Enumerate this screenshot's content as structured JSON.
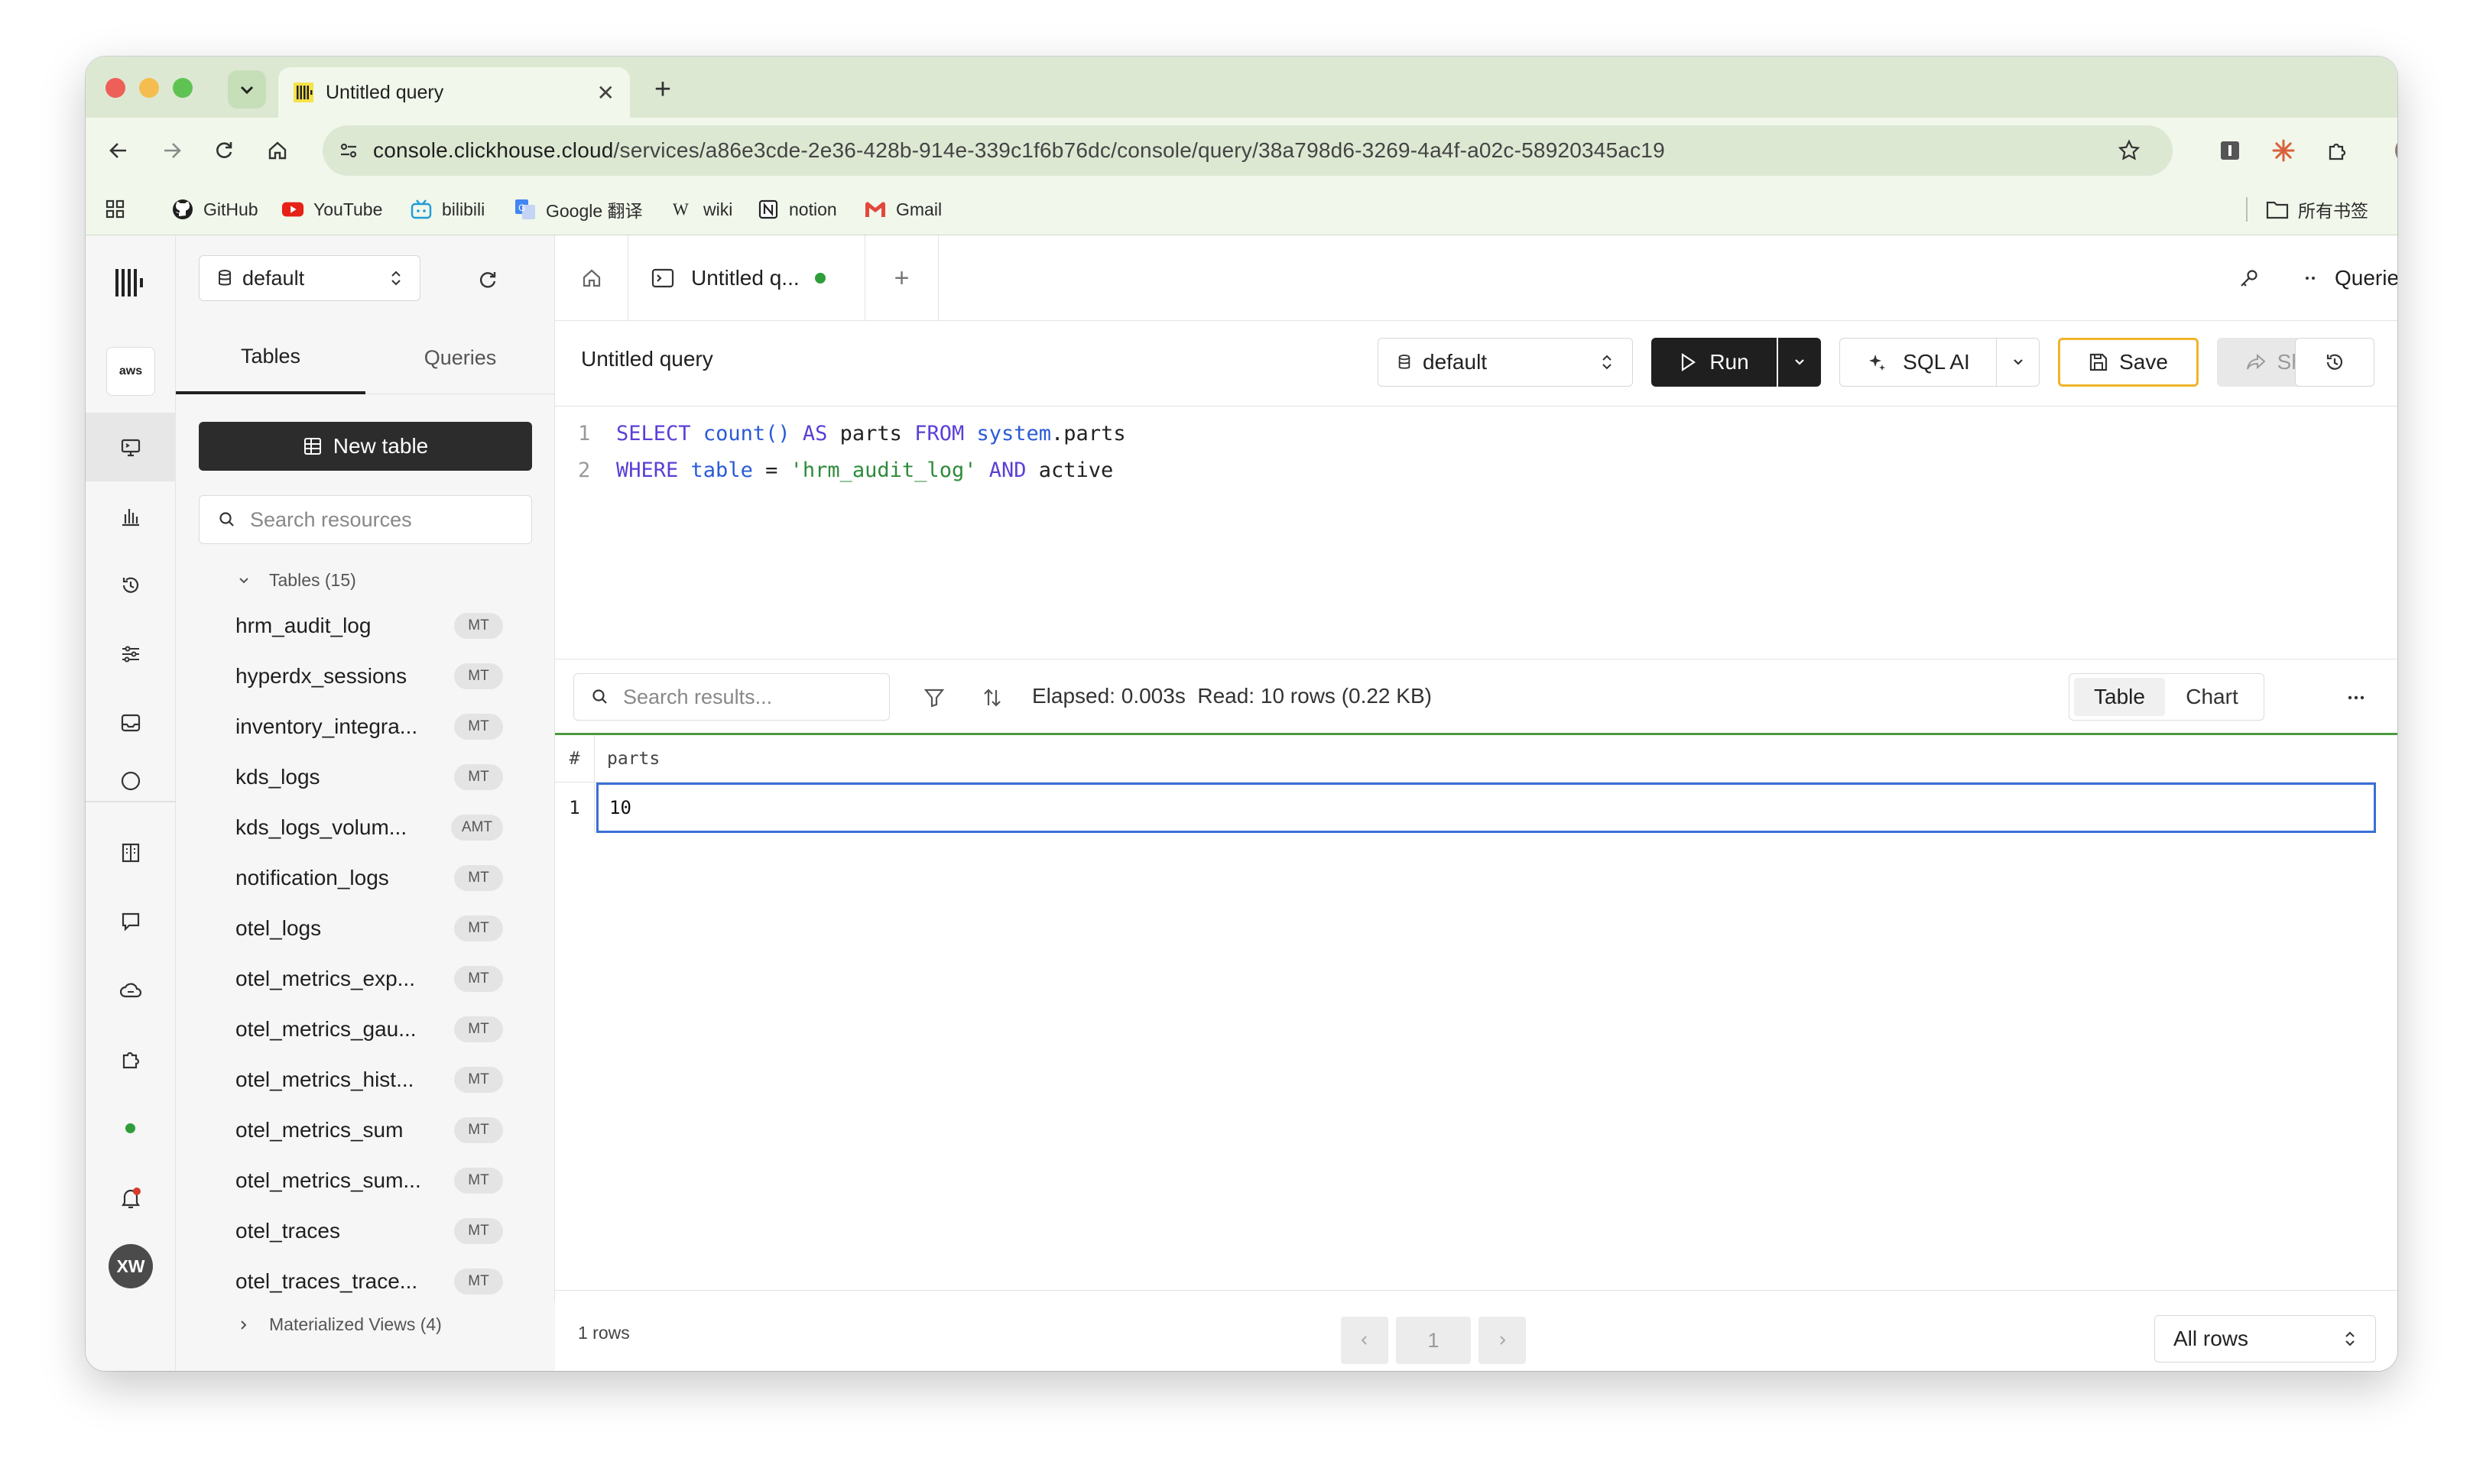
{
  "browser": {
    "tab_title": "Untitled query",
    "url_host": "console.clickhouse.cloud",
    "url_path": "/services/a86e3cde-2e36-428b-914e-339c1f6b76dc/console/query/38a798d6-3269-4a4f-a02c-58920345ac19",
    "bookmarks": [
      "GitHub",
      "YouTube",
      "bilibili",
      "Google 翻译",
      "wiki",
      "notion",
      "Gmail"
    ],
    "bookmarks_folder": "所有书签"
  },
  "sidebar": {
    "database": "default",
    "tabs": [
      "Tables",
      "Queries"
    ],
    "new_table": "New table",
    "search_placeholder": "Search resources",
    "tables_group": "Tables (15)",
    "tables": [
      {
        "name": "hrm_audit_log",
        "engine": "MT"
      },
      {
        "name": "hyperdx_sessions",
        "engine": "MT"
      },
      {
        "name": "inventory_integra...",
        "engine": "MT"
      },
      {
        "name": "kds_logs",
        "engine": "MT"
      },
      {
        "name": "kds_logs_volum...",
        "engine": "AMT"
      },
      {
        "name": "notification_logs",
        "engine": "MT"
      },
      {
        "name": "otel_logs",
        "engine": "MT"
      },
      {
        "name": "otel_metrics_exp...",
        "engine": "MT"
      },
      {
        "name": "otel_metrics_gau...",
        "engine": "MT"
      },
      {
        "name": "otel_metrics_hist...",
        "engine": "MT"
      },
      {
        "name": "otel_metrics_sum",
        "engine": "MT"
      },
      {
        "name": "otel_metrics_sum...",
        "engine": "MT"
      },
      {
        "name": "otel_traces",
        "engine": "MT"
      },
      {
        "name": "otel_traces_trace...",
        "engine": "MT"
      }
    ],
    "mv_group": "Materialized Views (4)"
  },
  "rail": {
    "avatar": "XW",
    "aws": "aws"
  },
  "query_tabs": {
    "active": "Untitled q...",
    "queries_label": "Queries"
  },
  "query_bar": {
    "title": "Untitled query",
    "database": "default",
    "run": "Run",
    "sql_ai": "SQL AI",
    "save": "Save",
    "share": "Share"
  },
  "editor": {
    "line_numbers": [
      "1",
      "2"
    ],
    "line1": {
      "k1": "SELECT",
      "f1": "count()",
      "k2": "AS",
      "t1": "parts",
      "k3": "FROM",
      "t2": "system",
      "t3": ".parts"
    },
    "line2": {
      "k1": "WHERE",
      "t1": "table",
      "op": "=",
      "s1": "'hrm_audit_log'",
      "k2": "AND",
      "t2": "active"
    }
  },
  "results": {
    "search_placeholder": "Search results...",
    "stats": "Elapsed: 0.003s  Read: 10 rows (0.22 KB)",
    "view_table": "Table",
    "view_chart": "Chart",
    "columns": [
      "#",
      "parts"
    ],
    "rows": [
      [
        "1",
        "10"
      ]
    ],
    "row_count": "1 rows",
    "page": "1",
    "rows_select": "All rows"
  },
  "colors": {
    "accent_green": "#4a9a3c",
    "save_border": "#f0b429",
    "run_bg": "#1f1f1f",
    "selection_blue": "#3b6fd6"
  }
}
